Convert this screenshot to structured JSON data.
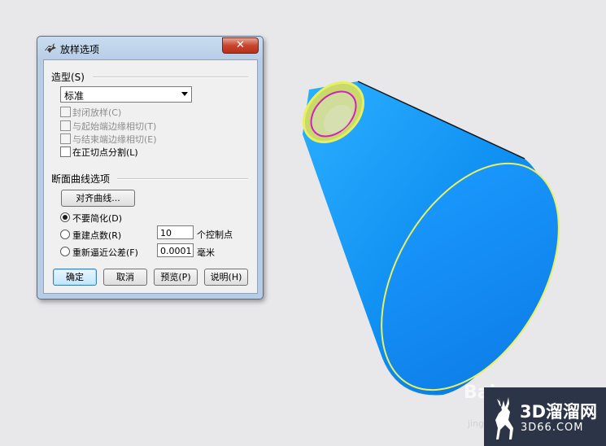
{
  "dialog": {
    "title": "放样选项",
    "close_label": "✕",
    "style_group": {
      "label": "造型(S)",
      "select_value": "标准",
      "checkboxes": [
        {
          "label": "封闭放样(C)",
          "checked": false,
          "enabled": false
        },
        {
          "label": "与起始端边缘相切(T)",
          "checked": false,
          "enabled": false
        },
        {
          "label": "与结束端边缘相切(E)",
          "checked": false,
          "enabled": false
        },
        {
          "label": "在正切点分割(L)",
          "checked": false,
          "enabled": true
        }
      ]
    },
    "section_group": {
      "label": "断面曲线选项",
      "align_button": "对齐曲线...",
      "radios": [
        {
          "label": "不要简化(D)",
          "selected": true
        },
        {
          "label": "重建点数(R)",
          "selected": false,
          "value": "10",
          "unit": "个控制点"
        },
        {
          "label": "重新逼近公差(F)",
          "selected": false,
          "value": "0.0001",
          "unit": "毫米"
        }
      ]
    },
    "buttons": {
      "ok": "确定",
      "cancel": "取消",
      "preview": "预览(P)",
      "help": "说明(H)"
    }
  },
  "viewport": {
    "surface_color": "#1aa0f5",
    "edge_color": "#e8f060",
    "selected_curve_color": "#d020c0"
  },
  "watermark": {
    "name": "3D溜溜网",
    "url": "3D66.COM",
    "bg_text": "Bai",
    "bg_sub": "jingy"
  }
}
